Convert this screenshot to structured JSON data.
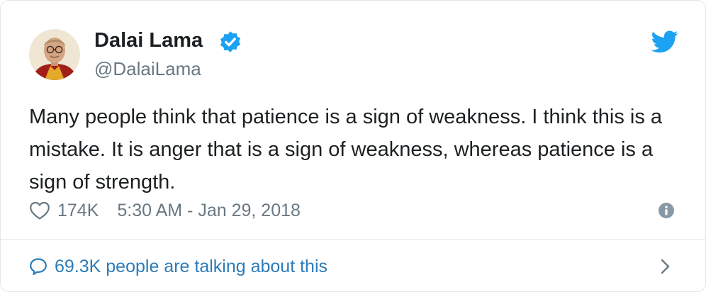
{
  "user": {
    "display_name": "Dalai Lama",
    "handle": "@DalaiLama",
    "verified": true
  },
  "tweet": {
    "text": "Many people think that patience is a sign of weakness. I think this is a mistake. It is anger that is a sign of weakness, whereas patience is a sign of strength.",
    "likes": "174K",
    "timestamp": "5:30 AM - Jan 29, 2018"
  },
  "footer": {
    "conversation_label": "69.3K people are talking about this"
  },
  "icons": {
    "brand": "twitter-bird-icon",
    "verified": "verified-badge-icon",
    "like": "heart-icon",
    "info": "info-icon",
    "conversation": "speech-bubble-icon",
    "more": "chevron-right-icon"
  },
  "colors": {
    "twitter_blue": "#1da1f2",
    "link_blue": "#2b7bb9",
    "text": "#1c2022",
    "muted": "#697882",
    "border": "#e1e8ed"
  }
}
